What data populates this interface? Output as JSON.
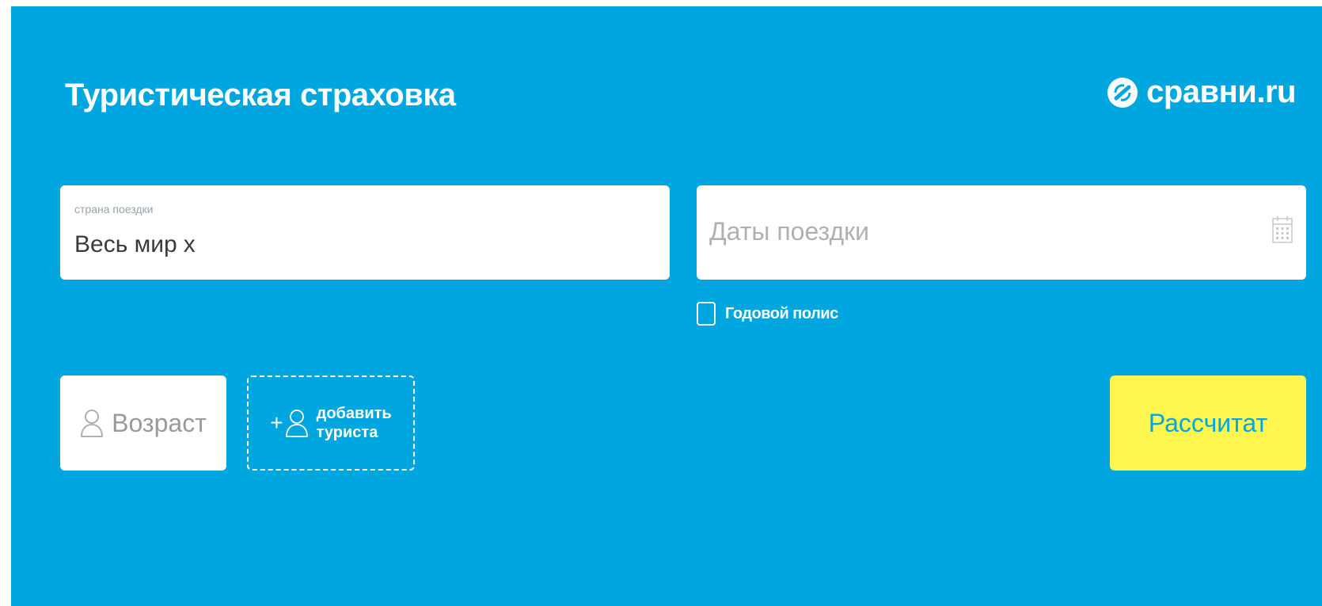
{
  "header": {
    "title": "Туристическая страховка",
    "logo_text": "сравни.ru"
  },
  "form": {
    "country": {
      "label": "страна поездки",
      "value": "Весь мир",
      "clear_glyph": "x"
    },
    "dates": {
      "placeholder": "Даты поездки",
      "icon": "calendar-icon"
    },
    "annual_policy": {
      "label": "Годовой полис",
      "checked": false
    },
    "age": {
      "placeholder": "Возраст",
      "icon": "person-icon"
    },
    "add_tourist": {
      "plus": "+",
      "label_line1": "добавить",
      "label_line2": "туриста",
      "icon": "person-icon"
    },
    "submit": {
      "label": "Рассчитат"
    }
  },
  "colors": {
    "background": "#00a6df",
    "accent_button": "#fff74f",
    "text_white": "#ffffff"
  }
}
